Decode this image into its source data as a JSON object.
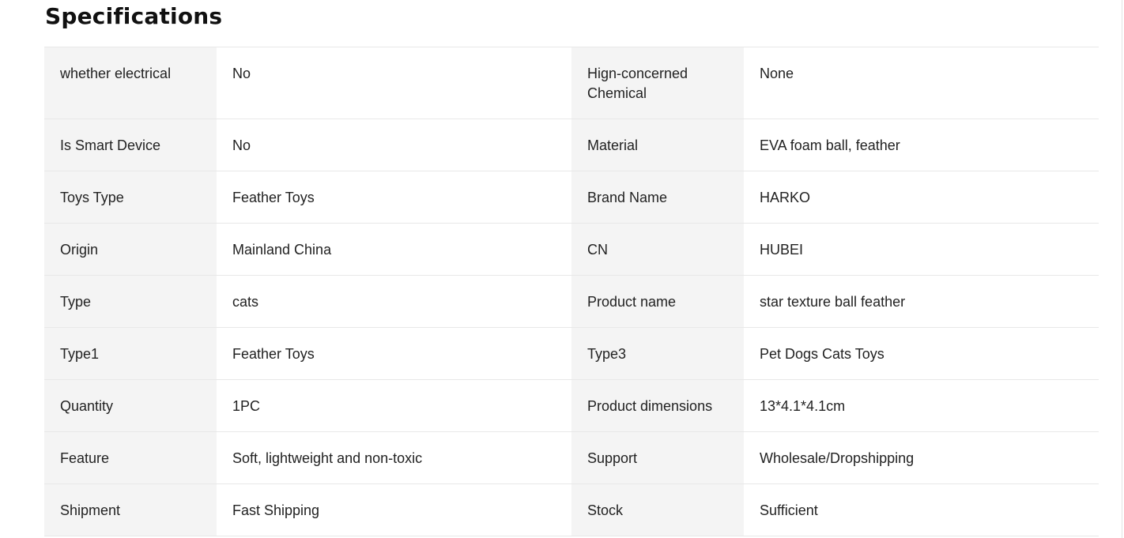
{
  "title": "Specifications",
  "rows": [
    {
      "k1": "whether electrical",
      "v1": "No",
      "k2": "Hign-concerned Chemical",
      "v2": "None"
    },
    {
      "k1": "Is Smart Device",
      "v1": "No",
      "k2": "Material",
      "v2": "EVA foam ball, feather"
    },
    {
      "k1": "Toys Type",
      "v1": "Feather Toys",
      "k2": "Brand Name",
      "v2": "HARKO"
    },
    {
      "k1": "Origin",
      "v1": "Mainland China",
      "k2": "CN",
      "v2": "HUBEI"
    },
    {
      "k1": "Type",
      "v1": "cats",
      "k2": "Product name",
      "v2": "star texture ball feather"
    },
    {
      "k1": "Type1",
      "v1": "Feather Toys",
      "k2": "Type3",
      "v2": "Pet Dogs Cats Toys"
    },
    {
      "k1": "Quantity",
      "v1": "1PC",
      "k2": "Product dimensions",
      "v2": "13*4.1*4.1cm"
    },
    {
      "k1": "Feature",
      "v1": "Soft, lightweight and non-toxic",
      "k2": "Support",
      "v2": "Wholesale/Dropshipping"
    },
    {
      "k1": "Shipment",
      "v1": "Fast Shipping",
      "k2": "Stock",
      "v2": "Sufficient"
    }
  ]
}
